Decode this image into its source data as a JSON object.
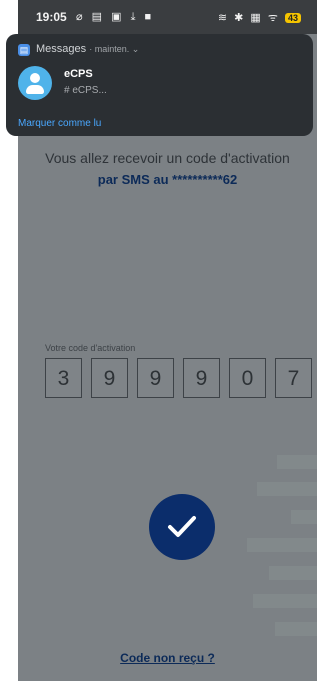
{
  "status_bar": {
    "time": "19:05",
    "left_icons": "⌀ ▤ ▣ ⤓ ■",
    "right_icons": "≋ ✱ ▦ ᯤ",
    "battery": "43"
  },
  "notification": {
    "app_name": "Messages",
    "app_sub": "· mainten. ⌄",
    "title": "eCPS",
    "text": "# eCPS...",
    "action": "Marquer comme lu"
  },
  "main": {
    "message_line1": "Vous allez recevoir un code d'activation",
    "message_line2": "par SMS au **********62",
    "code_label": "Votre code d'activation",
    "code_digits": [
      "3",
      "9",
      "9",
      "9",
      "0",
      "7"
    ],
    "resend_link": "Code non reçu ?"
  },
  "colors": {
    "primary": "#0b2d6b",
    "overlay": "#7c8185"
  }
}
